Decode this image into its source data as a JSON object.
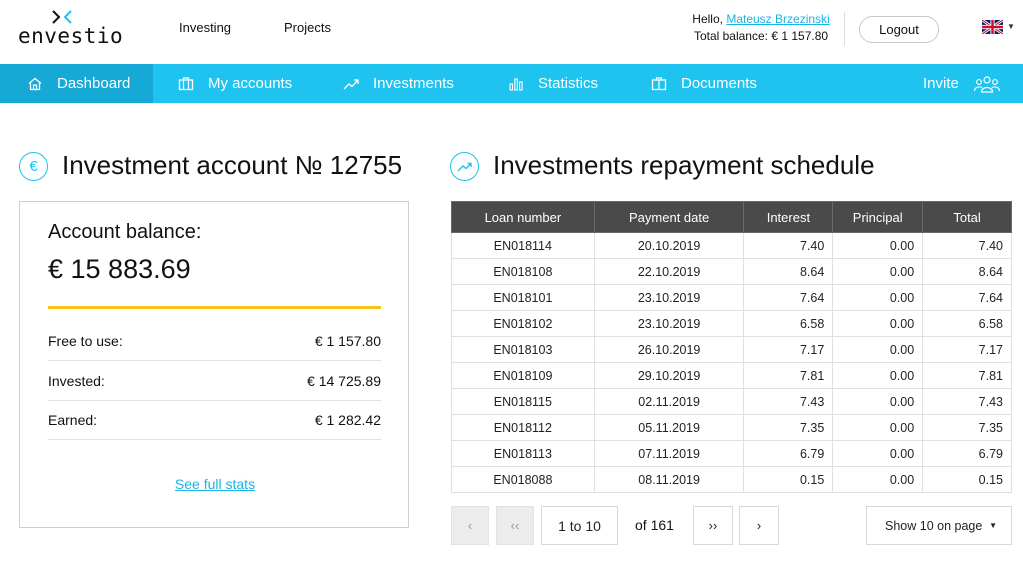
{
  "brand": {
    "name": "envestio"
  },
  "top_nav": [
    {
      "label": "Investing"
    },
    {
      "label": "Projects"
    }
  ],
  "user": {
    "greeting": "Hello,",
    "name": "Mateusz Brzezinski",
    "balance_label": "Total balance:",
    "balance_value": "€ 1 157.80"
  },
  "logout_label": "Logout",
  "language": {
    "icon": "uk-flag-icon"
  },
  "nav": {
    "items": [
      {
        "label": "Dashboard",
        "icon": "home-icon",
        "active": true
      },
      {
        "label": "My accounts",
        "icon": "accounts-icon",
        "active": false
      },
      {
        "label": "Investments",
        "icon": "trend-icon",
        "active": false
      },
      {
        "label": "Statistics",
        "icon": "bar-chart-icon",
        "active": false
      },
      {
        "label": "Documents",
        "icon": "documents-icon",
        "active": false
      }
    ],
    "invite_label": "Invite"
  },
  "account": {
    "title": "Investment account № 12755",
    "icon": "euro-icon",
    "balance_label": "Account balance:",
    "balance_value": "€ 15 883.69",
    "rows": [
      {
        "label": "Free to use:",
        "value": "€ 1 157.80"
      },
      {
        "label": "Invested:",
        "value": "€ 14 725.89"
      },
      {
        "label": "Earned:",
        "value": "€ 1 282.42"
      }
    ],
    "stats_link": "See full stats"
  },
  "schedule": {
    "title": "Investments repayment schedule",
    "icon": "trend-circle-icon",
    "columns": [
      "Loan number",
      "Payment date",
      "Interest",
      "Principal",
      "Total"
    ],
    "rows": [
      [
        "EN018114",
        "20.10.2019",
        "7.40",
        "0.00",
        "7.40"
      ],
      [
        "EN018108",
        "22.10.2019",
        "8.64",
        "0.00",
        "8.64"
      ],
      [
        "EN018101",
        "23.10.2019",
        "7.64",
        "0.00",
        "7.64"
      ],
      [
        "EN018102",
        "23.10.2019",
        "6.58",
        "0.00",
        "6.58"
      ],
      [
        "EN018103",
        "26.10.2019",
        "7.17",
        "0.00",
        "7.17"
      ],
      [
        "EN018109",
        "29.10.2019",
        "7.81",
        "0.00",
        "7.81"
      ],
      [
        "EN018115",
        "02.11.2019",
        "7.43",
        "0.00",
        "7.43"
      ],
      [
        "EN018112",
        "05.11.2019",
        "7.35",
        "0.00",
        "7.35"
      ],
      [
        "EN018113",
        "07.11.2019",
        "6.79",
        "0.00",
        "6.79"
      ],
      [
        "EN018088",
        "08.11.2019",
        "0.15",
        "0.00",
        "0.15"
      ]
    ]
  },
  "pagination": {
    "first": "‹",
    "prev": "‹‹",
    "range": "1 to 10",
    "of": "of 161",
    "next": "››",
    "last": "›",
    "page_size": "Show 10 on page"
  },
  "colors": {
    "accent": "#1ec3f0",
    "accent_dark": "#17a9d6",
    "highlight": "#f6c416",
    "table_header": "#4a4a4a"
  }
}
